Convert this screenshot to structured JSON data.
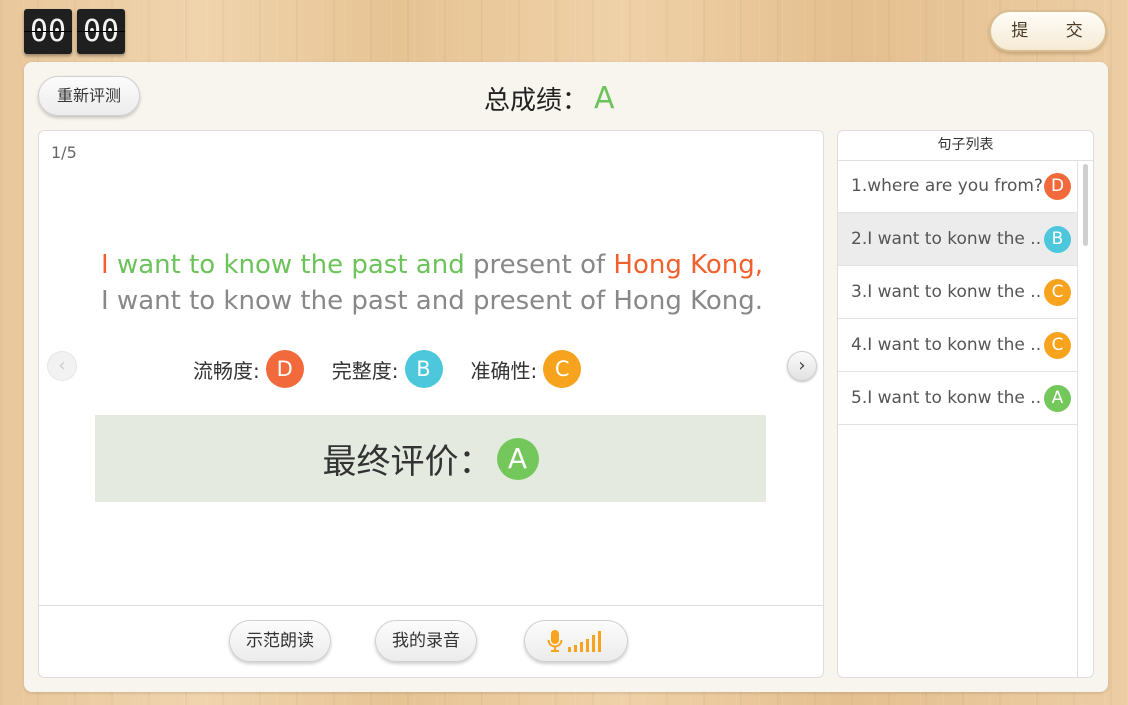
{
  "timer": {
    "minutes": "00",
    "seconds": "00"
  },
  "submit_label": "提 交",
  "retest_label": "重新评测",
  "total": {
    "label": "总成绩：",
    "grade": "A"
  },
  "counter": "1/5",
  "sentence": {
    "student_parts": [
      {
        "text": "I ",
        "color": "#f0612e"
      },
      {
        "text": "want to  know the past and ",
        "color": "#6cc35a"
      },
      {
        "text": "present of ",
        "color": "#888888"
      },
      {
        "text": "Hong Kong,",
        "color": "#f0612e"
      }
    ],
    "reference": "I want to  know the past and present of Hong Kong."
  },
  "metrics": [
    {
      "label": "流畅度:",
      "grade": "D"
    },
    {
      "label": "完整度:",
      "grade": "B"
    },
    {
      "label": "准确性:",
      "grade": "C"
    }
  ],
  "final": {
    "label": "最终评价：",
    "grade": "A"
  },
  "buttons": {
    "demo": "示范朗读",
    "mine": "我的录音"
  },
  "icons": {
    "prev": "chevron-left-icon",
    "next": "chevron-right-icon",
    "mic": "microphone-icon",
    "level": "signal-bars-icon"
  },
  "colors": {
    "D": "#f26a3c",
    "B": "#4cc7dc",
    "C": "#f8a31e",
    "A": "#74c75b",
    "accent_mic": "#f8a31e"
  },
  "list": {
    "title": "句子列表",
    "items": [
      {
        "text": "1.where are you from?",
        "grade": "D"
      },
      {
        "text": "2.I want to konw the ...",
        "grade": "B"
      },
      {
        "text": "3.I want to konw the ...",
        "grade": "C"
      },
      {
        "text": "4.I want to konw the ...",
        "grade": "C"
      },
      {
        "text": "5.I want to konw the ...",
        "grade": "A"
      }
    ],
    "selected_index": 1
  }
}
